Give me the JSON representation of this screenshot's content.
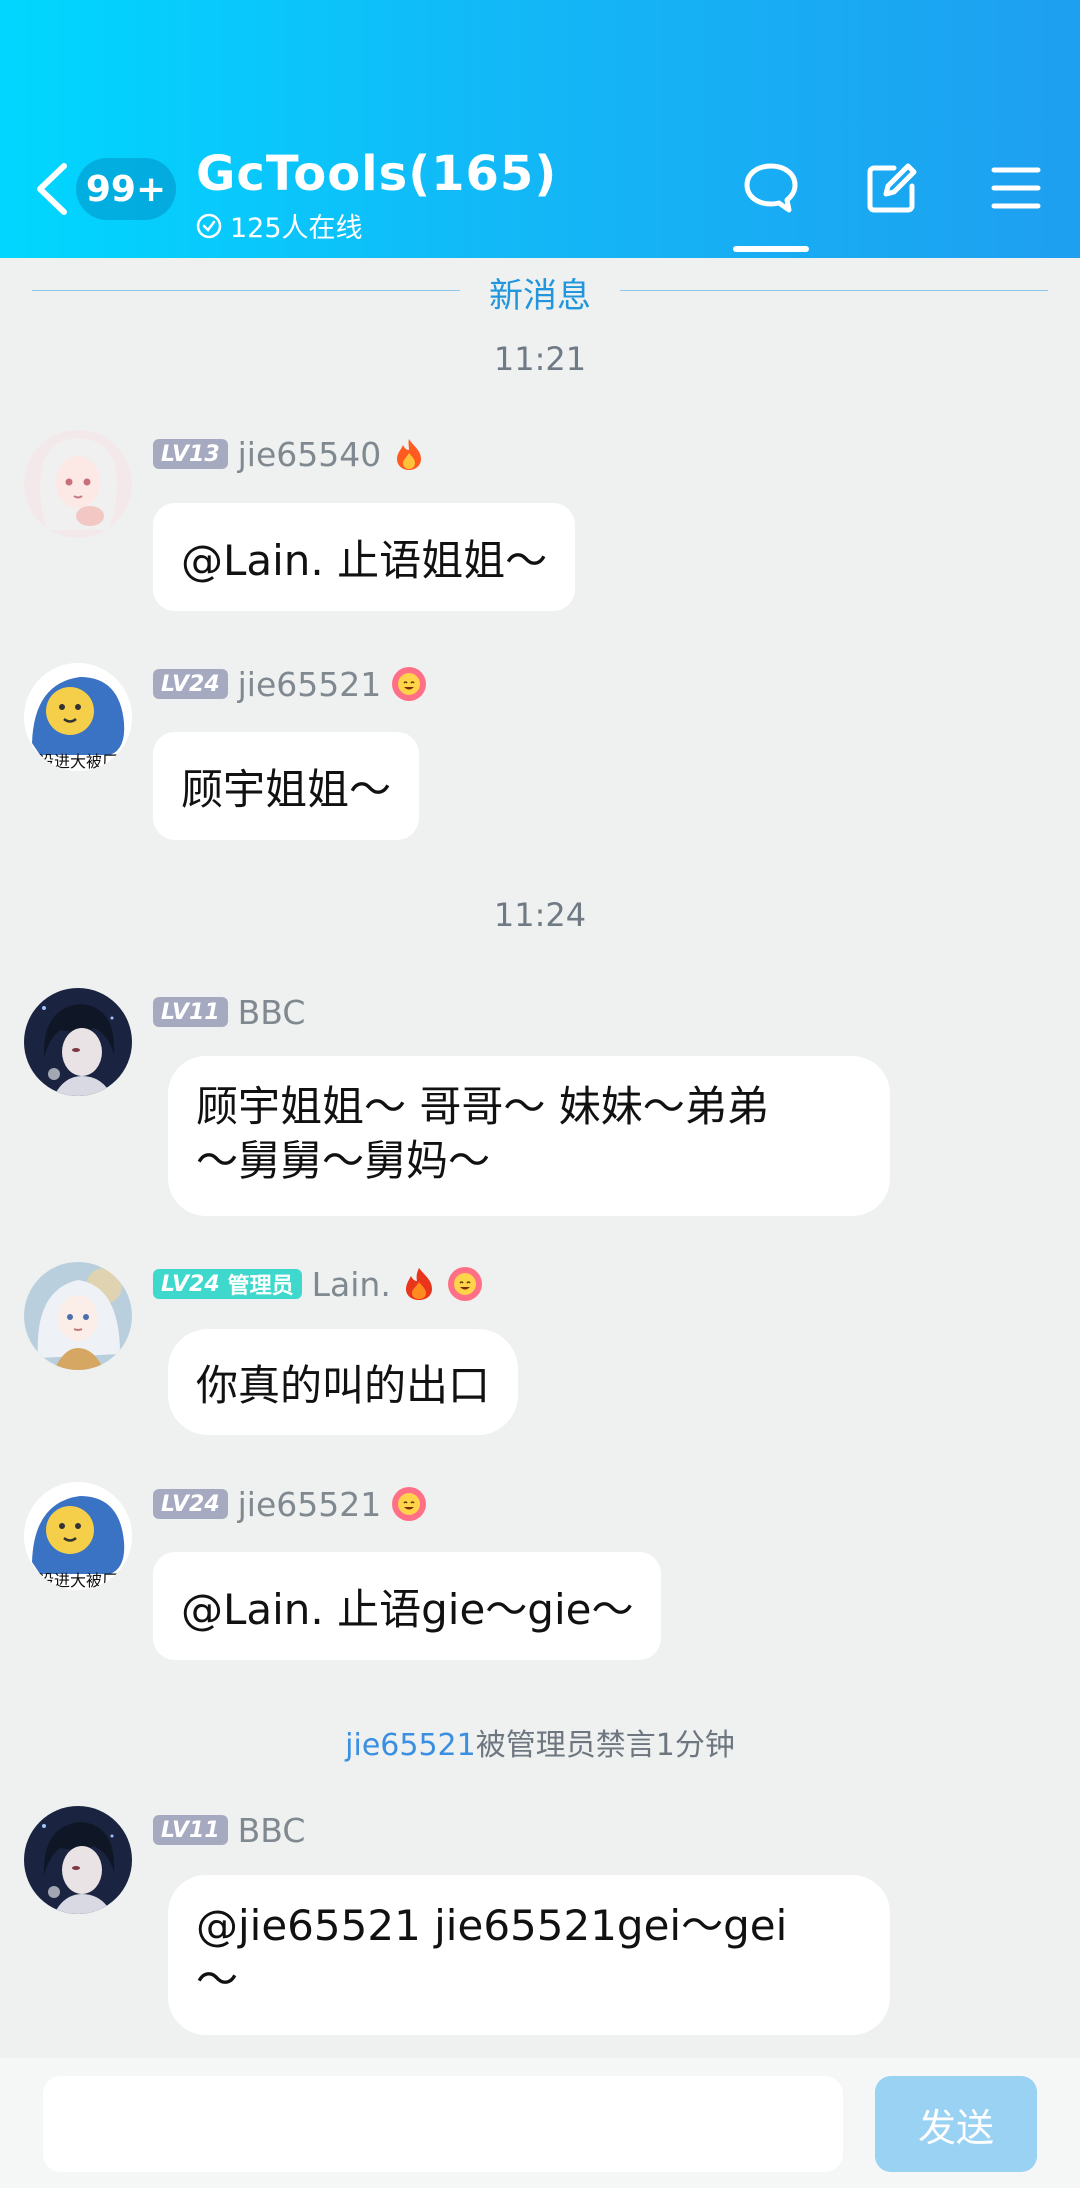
{
  "header": {
    "unread_badge": "99+",
    "title": "GcTools(165)",
    "online": "125人在线"
  },
  "new_message_divider": "新消息",
  "messages": [
    {
      "type": "time",
      "text": "11:21"
    },
    {
      "type": "msg",
      "level": "LV13",
      "user": "jie65540",
      "badge_icon": "fire-icon",
      "text": "@Lain. 止语姐姐～"
    },
    {
      "type": "msg",
      "level": "LV24",
      "user": "jie65521",
      "badge_icon": "flower-face-icon",
      "text": "顾宇姐姐～"
    },
    {
      "type": "time",
      "text": "11:24"
    },
    {
      "type": "msg",
      "level": "LV11",
      "user": "BBC",
      "text_lines": [
        "顾宇姐姐～ 哥哥～ 妹妹～弟弟",
        "～舅舅～舅妈～"
      ]
    },
    {
      "type": "msg",
      "level": "LV24",
      "role": "管理员",
      "user": "Lain.",
      "badge_icons": [
        "flame-icon",
        "flower-face-icon"
      ],
      "text": "你真的叫的出口"
    },
    {
      "type": "msg",
      "level": "LV24",
      "user": "jie65521",
      "badge_icon": "flower-face-icon",
      "text": "@Lain. 止语gie～gie～"
    },
    {
      "type": "system",
      "user": "jie65521",
      "text": "被管理员禁言1分钟"
    },
    {
      "type": "msg",
      "level": "LV11",
      "user": "BBC",
      "text_lines": [
        "@jie65521  jie65521gei～gei",
        "～"
      ]
    }
  ],
  "composer": {
    "send_label": "发送"
  },
  "colors": {
    "header_gradient": [
      "#00d7ff",
      "#1e9ff0"
    ],
    "admin_badge": "#3ed9cc",
    "level_badge": "#a6aac1",
    "send_button": "#9ad2f4",
    "link": "#3a8fe0"
  }
}
